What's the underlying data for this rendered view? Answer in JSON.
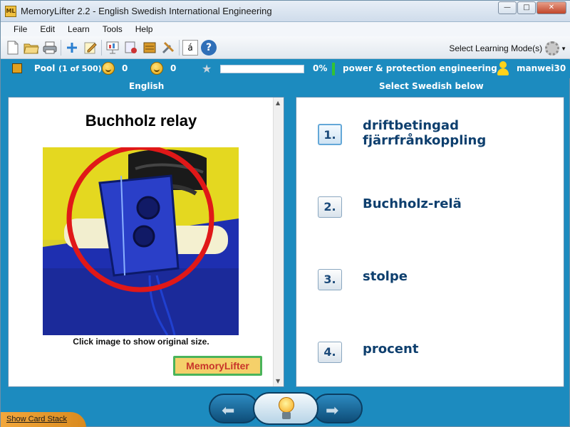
{
  "window": {
    "app_icon_text": "ML",
    "title": "MemoryLifter 2.2 - English Swedish International Engineering",
    "buttons": {
      "minimize": "—",
      "maximize": "□",
      "close": "✕"
    }
  },
  "menu": [
    "File",
    "Edit",
    "Learn",
    "Tools",
    "Help"
  ],
  "toolbar": {
    "icons": [
      "new-file-icon",
      "open-folder-icon",
      "print-icon",
      "add-icon",
      "edit-icon",
      "presentation-icon",
      "cards-icon",
      "card-box-icon",
      "settings-tools-icon",
      "character-map-icon",
      "help-icon"
    ],
    "char_label": "á",
    "help_label": "?",
    "mode_label": "Select Learning Mode(s)"
  },
  "status": {
    "pool_label": "Pool",
    "pool_count": "(1 of 500)",
    "happy_count": "0",
    "sad_count": "0",
    "progress_percent_label": "0%",
    "progress_value": 0,
    "category": "power & protection engineering",
    "user": "manwei30"
  },
  "question_column": {
    "header": "English"
  },
  "answer_column": {
    "header": "Select Swedish below"
  },
  "card": {
    "question": "Buchholz relay",
    "image_hint": "Click image to show original size.",
    "logo_text": "MemoryLifter"
  },
  "answers": [
    {
      "num": "1.",
      "text": "driftbetingad fjärrfrånkoppling",
      "selected": true
    },
    {
      "num": "2.",
      "text": "Buchholz-relä",
      "selected": false
    },
    {
      "num": "3.",
      "text": "stolpe",
      "selected": false
    },
    {
      "num": "4.",
      "text": "procent",
      "selected": false
    }
  ],
  "bottom": {
    "show_card_stack": "Show Card Stack",
    "prev_arrow": "⬅",
    "next_arrow": "➡"
  }
}
